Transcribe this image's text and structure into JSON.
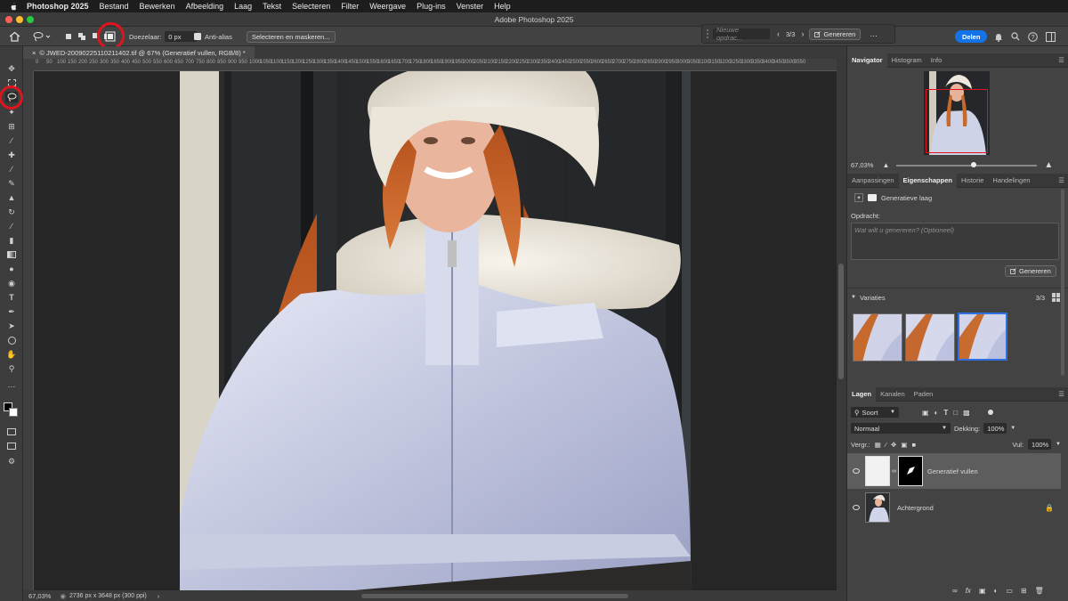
{
  "menubar": {
    "items": [
      "Photoshop 2025",
      "Bestand",
      "Bewerken",
      "Afbeelding",
      "Laag",
      "Tekst",
      "Selecteren",
      "Filter",
      "Weergave",
      "Plug-ins",
      "Venster",
      "Help"
    ]
  },
  "window": {
    "title": "Adobe Photoshop 2025"
  },
  "options": {
    "feather_label": "Doezelaar:",
    "feather_value": "0 px",
    "antialias_label": "Anti-alias",
    "select_mask_label": "Selecteren en maskeren...",
    "prompt_placeholder": "Nieuwe opdrac...",
    "variation_counter": "3/3",
    "generate_label": "Genereren",
    "share_label": "Delen"
  },
  "document": {
    "tab_title": "© JWED-20090225110211402.tif @ 67% (Generatief vullen, RGB/8) *",
    "ruler_labels": [
      "0",
      "50",
      "100",
      "150",
      "200",
      "250",
      "300",
      "350",
      "400",
      "450",
      "500",
      "550",
      "600",
      "650",
      "700",
      "750",
      "800",
      "850",
      "900",
      "950",
      "1000",
      "1050",
      "1100",
      "1150",
      "1200",
      "1250",
      "1300",
      "1350",
      "1400",
      "1450",
      "1500",
      "1550",
      "1600",
      "1650",
      "1700",
      "1750",
      "1800",
      "1850",
      "1900",
      "1950",
      "2000",
      "2050",
      "2100",
      "2150",
      "2200",
      "2250",
      "2300",
      "2350",
      "2400",
      "2450",
      "2500",
      "2550",
      "2600",
      "2650",
      "2700",
      "2750",
      "2800",
      "2850",
      "2900",
      "2950",
      "3000",
      "3050",
      "3100",
      "3150",
      "3200",
      "3250",
      "3300",
      "3350",
      "3400",
      "3450",
      "3500",
      "3550"
    ]
  },
  "status": {
    "zoom": "67,03%",
    "info": "2736 px x 3648 px (300 ppi)"
  },
  "navigator": {
    "tabs": [
      "Navigator",
      "Histogram",
      "Info"
    ],
    "zoom": "67,03%",
    "zoom_fraction": 0.55
  },
  "properties": {
    "tabs": [
      "Aanpassingen",
      "Eigenschappen",
      "Historie",
      "Handelingen"
    ],
    "layer_type": "Generatieve laag",
    "prompt_label": "Opdracht:",
    "prompt_placeholder": "Wat wilt u genereren? (Optioneel)",
    "generate_label": "Genereren",
    "variations_label": "Variaties",
    "variations_count": "3/3"
  },
  "layers": {
    "tabs": [
      "Lagen",
      "Kanalen",
      "Paden"
    ],
    "filter_label": "Soort",
    "blend_mode": "Normaal",
    "opacity_label": "Dekking:",
    "opacity_value": "100%",
    "lock_label": "Vergr.:",
    "fill_label": "Vul:",
    "fill_value": "100%",
    "items": [
      {
        "name": "Generatief vullen"
      },
      {
        "name": "Achtergrond"
      }
    ]
  },
  "colors": {
    "accent": "#1473e6",
    "highlight_circle": "#e0141e",
    "selected_thumb": "#2f6fe0"
  }
}
